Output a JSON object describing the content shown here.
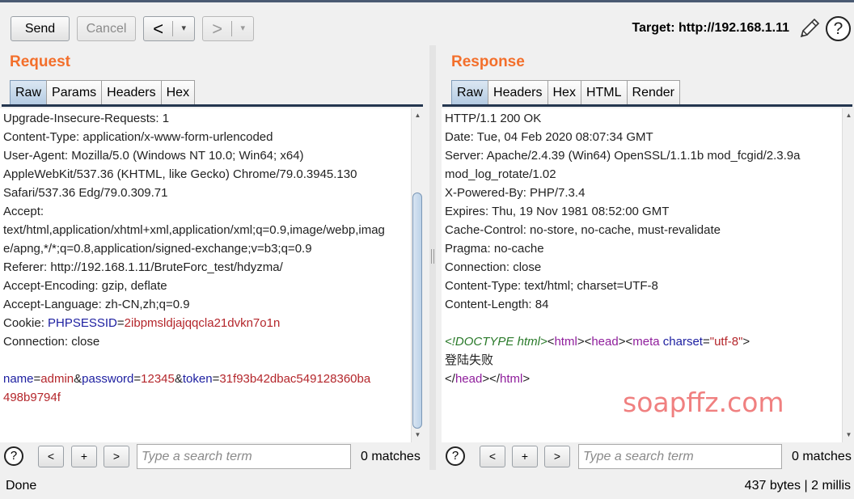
{
  "toolbar": {
    "send_label": "Send",
    "cancel_label": "Cancel",
    "back_arrow": "<",
    "forward_arrow": ">",
    "dropdown_glyph": "▾",
    "target_label": "Target: http://192.168.1.11",
    "help_glyph": "?"
  },
  "request": {
    "title": "Request",
    "tabs": [
      {
        "label": "Raw",
        "active": true
      },
      {
        "label": "Params"
      },
      {
        "label": "Headers"
      },
      {
        "label": "Hex"
      }
    ],
    "lines": [
      "Upgrade-Insecure-Requests: 1",
      "Content-Type: application/x-www-form-urlencoded",
      "User-Agent: Mozilla/5.0 (Windows NT 10.0; Win64; x64)",
      "AppleWebKit/537.36 (KHTML, like Gecko) Chrome/79.0.3945.130",
      "Safari/537.36 Edg/79.0.309.71",
      "Accept:",
      "text/html,application/xhtml+xml,application/xml;q=0.9,image/webp,imag",
      "e/apng,*/*;q=0.8,application/signed-exchange;v=b3;q=0.9",
      "Referer: http://192.168.1.11/BruteForc_test/hdyzma/",
      "Accept-Encoding: gzip, deflate",
      "Accept-Language: zh-CN,zh;q=0.9"
    ],
    "cookie": {
      "prefix": "Cookie: ",
      "name": "PHPSESSID",
      "eq": "=",
      "value": "2ibpmsldjajqqcla21dvkn7o1n"
    },
    "connection": "Connection: close",
    "body": {
      "p1_name": "name",
      "p1_value": "admin",
      "p2_name": "password",
      "p2_value": "12345",
      "p3_name": "token",
      "p3_value": "31f93b42dbac549128360ba",
      "p3_value_cont": "498b9794f",
      "eq": "=",
      "amp": "&"
    },
    "search_placeholder": "Type a search term",
    "matches": "0 matches"
  },
  "response": {
    "title": "Response",
    "tabs": [
      {
        "label": "Raw",
        "active": true
      },
      {
        "label": "Headers"
      },
      {
        "label": "Hex"
      },
      {
        "label": "HTML"
      },
      {
        "label": "Render"
      }
    ],
    "lines": [
      "HTTP/1.1 200 OK",
      "Date: Tue, 04 Feb 2020 08:07:34 GMT",
      "Server: Apache/2.4.39 (Win64) OpenSSL/1.1.1b mod_fcgid/2.3.9a",
      "mod_log_rotate/1.02",
      "X-Powered-By: PHP/7.3.4",
      "Expires: Thu, 19 Nov 1981 08:52:00 GMT",
      "Cache-Control: no-store, no-cache, must-revalidate",
      "Pragma: no-cache",
      "Connection: close",
      "Content-Type: text/html; charset=UTF-8",
      "Content-Length: 84"
    ],
    "html": {
      "doctype": "<!DOCTYPE html>",
      "lt": "<",
      "gt": ">",
      "lt_close": "</",
      "tag_html": "html",
      "tag_head": "head",
      "tag_meta": "meta",
      "attr_charset": "charset",
      "eq": "=",
      "charset_value": "\"utf-8\"",
      "text": "登陆失败"
    },
    "search_placeholder": "Type a search term",
    "matches": "0 matches"
  },
  "search_nav": {
    "prev": "<",
    "add": "+",
    "next": ">"
  },
  "status": {
    "left": "Done",
    "right": "437 bytes | 2 millis"
  },
  "watermark": "soapffz.com",
  "colors": {
    "title_orange": "#f36f2b",
    "active_tab": "#b4cbe2",
    "param_name": "#1c1ea0",
    "param_value": "#b4262b",
    "html_tag": "#8f1e9c",
    "doctype": "#2a7a2a"
  }
}
